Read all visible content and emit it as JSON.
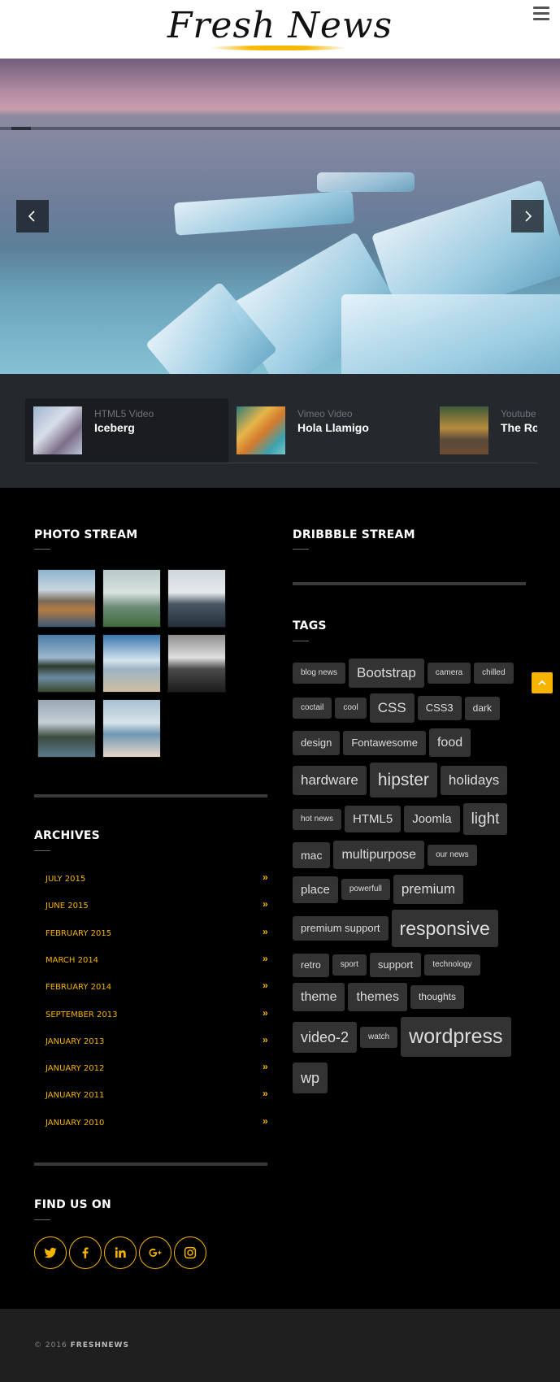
{
  "header": {
    "logo_text": "Fresh News",
    "menu_icon": "hamburger-menu-icon"
  },
  "hero": {
    "prev_icon": "chevron-left-icon",
    "next_icon": "chevron-right-icon"
  },
  "videos": [
    {
      "type": "HTML5 Video",
      "title": "Iceberg"
    },
    {
      "type": "Vimeo Video",
      "title": "Hola Llamigo"
    },
    {
      "type": "Youtube",
      "title": "The Ro Vietnar"
    }
  ],
  "photo_stream": {
    "title": "PHOTO STREAM"
  },
  "dribbble_stream": {
    "title": "DRIBBBLE STREAM"
  },
  "tags": {
    "title": "TAGS",
    "items": [
      "blog news",
      "Bootstrap",
      "camera",
      "chilled",
      "coctail",
      "cool",
      "CSS",
      "CSS3",
      "dark",
      "design",
      "Fontawesome",
      "food",
      "hardware",
      "hipster",
      "holidays",
      "hot news",
      "HTML5",
      "Joomla",
      "light",
      "mac",
      "multipurpose",
      "our news",
      "place",
      "powerfull",
      "premium",
      "premium support",
      "responsive",
      "retro",
      "sport",
      "support",
      "technology",
      "theme",
      "themes",
      "thoughts",
      "video-2",
      "watch",
      "wordpress",
      "wp"
    ]
  },
  "archives": {
    "title": "ARCHIVES",
    "chevron": "»",
    "items": [
      "JULY 2015",
      "JUNE 2015",
      "FEBRUARY 2015",
      "MARCH 2014",
      "FEBRUARY 2014",
      "SEPTEMBER 2013",
      "JANUARY 2013",
      "JANUARY 2012",
      "JANUARY 2011",
      "JANUARY 2010"
    ]
  },
  "find_us": {
    "title": "FIND US ON",
    "icons": [
      "twitter-icon",
      "facebook-icon",
      "linkedin-icon",
      "google-plus-icon",
      "instagram-icon"
    ]
  },
  "footer": {
    "copyright_prefix": "© 2016",
    "brand": "FRESHNEWS"
  },
  "colors": {
    "accent": "#f4b400",
    "strip_bg": "#25282c",
    "tag_bg": "#333333",
    "footer_bg": "#1f1f1f"
  }
}
